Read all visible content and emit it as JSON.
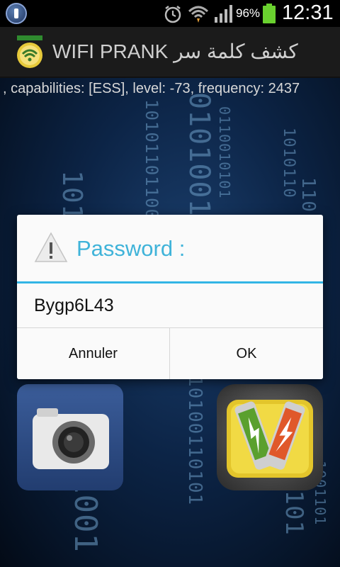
{
  "status_bar": {
    "battery_percent": "96%",
    "time": "12:31",
    "icons": [
      "app-notification-icon",
      "alarm-icon",
      "wifi-icon",
      "signal-icon",
      "battery-icon"
    ]
  },
  "app_bar": {
    "title": "WIFI PRANK كشف كلمة سر",
    "logo_icon": "wifi-logo-icon"
  },
  "scan_result_text": ", capabilities: [ESS], level: -73, frequency: 2437",
  "dialog": {
    "title": "Password :",
    "icon": "warning-icon",
    "message": "Bygp6L43",
    "buttons": {
      "cancel": "Annuler",
      "ok": "OK"
    },
    "accent_color": "#33b5e5"
  },
  "tiles": [
    {
      "name": "camera",
      "icon": "camera-icon"
    },
    {
      "name": "battery",
      "icon": "battery-charge-icon"
    }
  ]
}
